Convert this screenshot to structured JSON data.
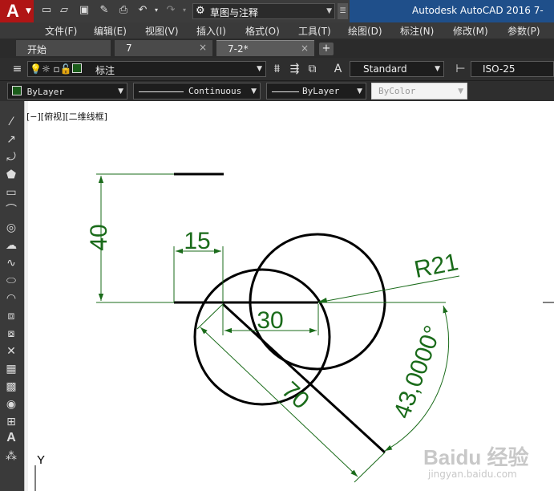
{
  "colors": {
    "app_red": "#b01515",
    "title_blue": "#1f4f8a",
    "dim_green": "#1a6b1a",
    "geometry": "#000000",
    "dark_ui": "#3a3a3a"
  },
  "title_bar": {
    "app_icon": "A",
    "quick_access_icons": [
      "new-icon",
      "open-icon",
      "save-icon",
      "saveas-icon",
      "print-icon",
      "undo-icon",
      "redo-icon"
    ],
    "workspace": "草图与注释",
    "title": "Autodesk AutoCAD 2016    7-"
  },
  "menu": [
    "文件(F)",
    "编辑(E)",
    "视图(V)",
    "插入(I)",
    "格式(O)",
    "工具(T)",
    "绘图(D)",
    "标注(N)",
    "修改(M)",
    "参数(P)"
  ],
  "tabs": [
    {
      "label": "开始",
      "close": "×"
    },
    {
      "label": "7",
      "close": "×"
    },
    {
      "label": "7-2*",
      "close": "×"
    }
  ],
  "tab_add": "+",
  "toolbar1": {
    "layer_name": "标注",
    "text_style": "Standard",
    "dim_style": "ISO-25"
  },
  "toolbar2": {
    "color": "ByLayer",
    "linetype": "Continuous",
    "lineweight": "ByLayer",
    "plotstyle": "ByColor"
  },
  "viewport_label": "[−][俯视][二维线框]",
  "drawing": {
    "dimensions": [
      "40",
      "15",
      "30",
      "70",
      "R21",
      "43,0000°"
    ],
    "ucs_label": "Y"
  },
  "watermark": {
    "brand": "Baidu 经验",
    "url": "jingyan.baidu.com"
  }
}
